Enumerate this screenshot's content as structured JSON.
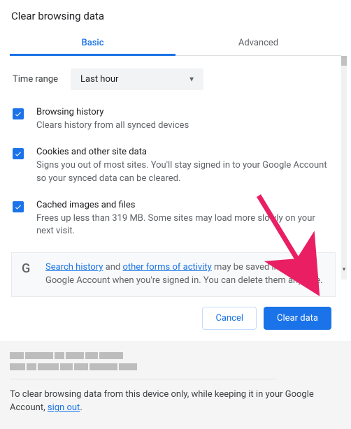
{
  "title": "Clear browsing data",
  "tabs": {
    "basic": "Basic",
    "advanced": "Advanced"
  },
  "timeRange": {
    "label": "Time range",
    "value": "Last hour"
  },
  "options": [
    {
      "title": "Browsing history",
      "sub": "Clears history from all synced devices",
      "checked": true
    },
    {
      "title": "Cookies and other site data",
      "sub": "Signs you out of most sites. You'll stay signed in to your Google Account so your synced data can be cleared.",
      "checked": true
    },
    {
      "title": "Cached images and files",
      "sub": "Frees up less than 319 MB. Some sites may load more slowly on your next visit.",
      "checked": true
    }
  ],
  "info": {
    "link1": "Search history",
    "mid1": " and ",
    "link2": "other forms of activity",
    "rest": " may be saved in your Google Account when you're signed in. You can delete them anytime."
  },
  "buttons": {
    "cancel": "Cancel",
    "clear": "Clear data"
  },
  "footer": {
    "text1": "To clear browsing data from this device only, while keeping it in your Google Account, ",
    "signout": "sign out",
    "text2": "."
  },
  "accent": "#1a73e8",
  "arrowColor": "#e91e63"
}
